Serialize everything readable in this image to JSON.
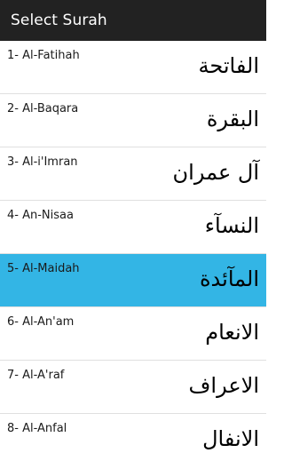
{
  "app_bar": {
    "title": "Select Surah"
  },
  "colors": {
    "app_bar_background": "#222222",
    "selected_row_background": "#33b5e5",
    "divider": "#e0e0e0"
  },
  "surahs": [
    {
      "label": "1- Al-Fatihah",
      "arabic": "الفاتحة",
      "selected": false
    },
    {
      "label": "2- Al-Baqara",
      "arabic": "البقرة",
      "selected": false
    },
    {
      "label": "3- Al-i'Imran",
      "arabic": "آل عمران",
      "selected": false
    },
    {
      "label": "4- An-Nisaa",
      "arabic": "النسآء",
      "selected": false
    },
    {
      "label": "5- Al-Maidah",
      "arabic": "المآئدة",
      "selected": true
    },
    {
      "label": "6- Al-An'am",
      "arabic": "الانعام",
      "selected": false
    },
    {
      "label": "7- Al-A'raf",
      "arabic": "الاعراف",
      "selected": false
    },
    {
      "label": "8- Al-Anfal",
      "arabic": "الانفال",
      "selected": false
    }
  ]
}
